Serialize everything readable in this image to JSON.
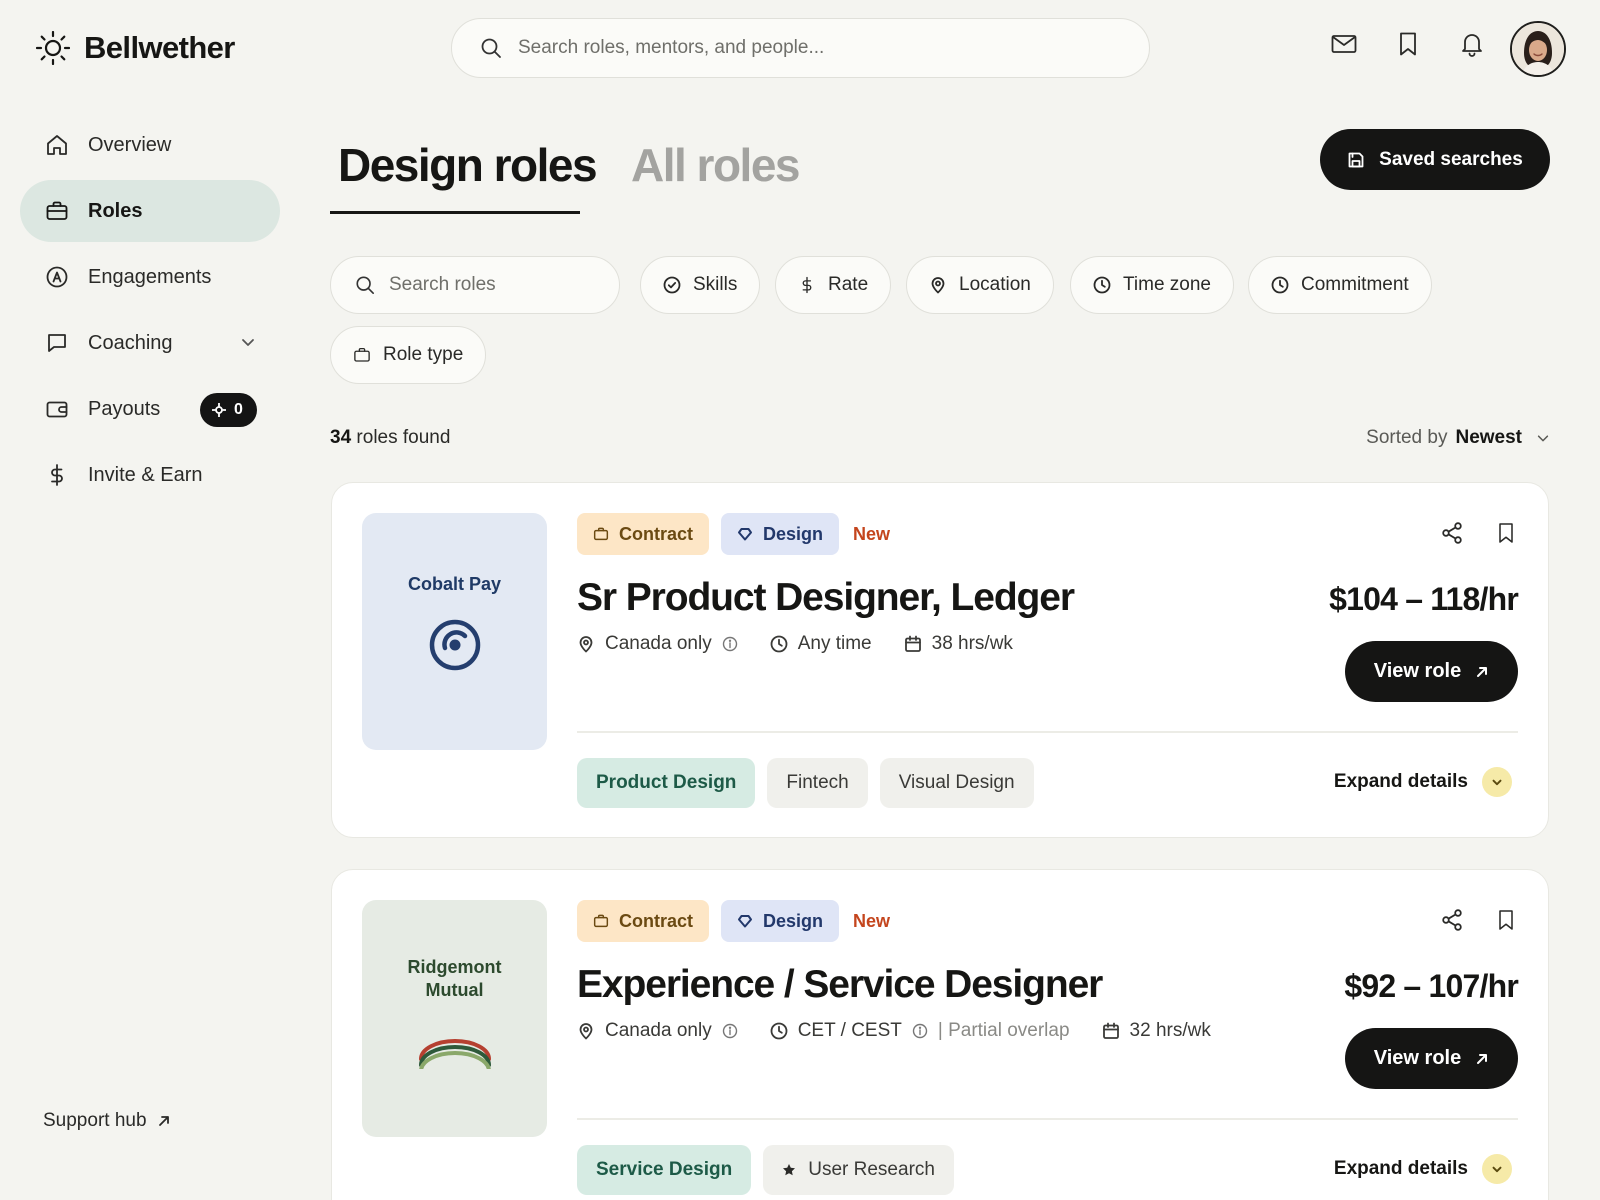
{
  "app": {
    "name": "Bellwether"
  },
  "search": {
    "placeholder": "Search roles, mentors, and people..."
  },
  "sidebar": {
    "items": [
      {
        "label": "Overview",
        "icon": "home-icon"
      },
      {
        "label": "Roles",
        "icon": "briefcase-icon",
        "active": true
      },
      {
        "label": "Engagements",
        "icon": "badge-a-icon"
      },
      {
        "label": "Coaching",
        "icon": "chat-icon",
        "has_chevron": true
      },
      {
        "label": "Payouts",
        "icon": "wallet-icon",
        "badge": "0"
      },
      {
        "label": "Invite & Earn",
        "icon": "dollar-icon"
      }
    ],
    "support": "Support hub"
  },
  "tabs": {
    "active": "Design roles",
    "inactive": "All roles"
  },
  "saved_searches": "Saved searches",
  "filters": {
    "search_placeholder": "Search roles",
    "chips": [
      "Skills",
      "Rate",
      "Location",
      "Time zone",
      "Commitment",
      "Role type"
    ]
  },
  "results": {
    "count": "34",
    "label": "roles found"
  },
  "sort": {
    "prefix": "Sorted by",
    "value": "Newest"
  },
  "roles": [
    {
      "company": "Cobalt Pay",
      "company_bg": "#e3e9f3",
      "company_color": "#1f3a66",
      "tags": {
        "type": "Contract",
        "category": "Design",
        "status": "New"
      },
      "title": "Sr Product Designer, Ledger",
      "rate": "$104 – 118/hr",
      "location": "Canada only",
      "timezone": "Any time",
      "overlap": "",
      "hours": "38 hrs/wk",
      "view": "View role",
      "skills": [
        "Product Design",
        "Fintech",
        "Visual Design"
      ],
      "expand": "Expand details"
    },
    {
      "company": "Ridgemont Mutual",
      "company_bg": "#e6ebe4",
      "company_color": "#2d4a2e",
      "tags": {
        "type": "Contract",
        "category": "Design",
        "status": "New"
      },
      "title": "Experience / Service Designer",
      "rate": "$92 – 107/hr",
      "location": "Canada only",
      "timezone": "CET / CEST",
      "overlap": "| Partial overlap",
      "hours": "32 hrs/wk",
      "view": "View role",
      "skills": [
        "Service Design",
        "User Research"
      ],
      "expand": "Expand details"
    }
  ]
}
